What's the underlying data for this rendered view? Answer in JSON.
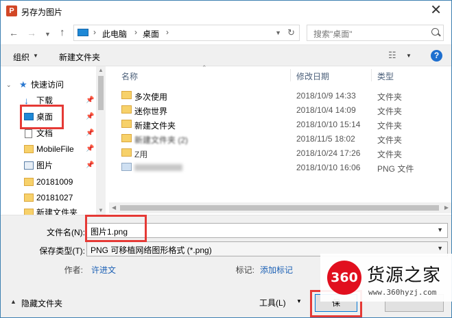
{
  "window": {
    "title": "另存为图片"
  },
  "nav": {
    "breadcrumbs": [
      "此电脑",
      "桌面"
    ],
    "search_placeholder": "搜索\"桌面\""
  },
  "toolbar": {
    "organize": "组织",
    "new_folder": "新建文件夹"
  },
  "sidebar": {
    "items": [
      {
        "label": "快速访问",
        "icon": "star-icon"
      },
      {
        "label": "下载",
        "icon": "download-icon"
      },
      {
        "label": "桌面",
        "icon": "desktop-icon"
      },
      {
        "label": "文档",
        "icon": "document-icon"
      },
      {
        "label": "MobileFile",
        "icon": "folder-icon"
      },
      {
        "label": "图片",
        "icon": "pictures-icon"
      },
      {
        "label": "20181009",
        "icon": "folder-icon"
      },
      {
        "label": "20181027",
        "icon": "folder-icon"
      },
      {
        "label": "新建文件夹",
        "icon": "folder-icon"
      }
    ]
  },
  "file_list": {
    "columns": [
      "名称",
      "修改日期",
      "类型"
    ],
    "rows": [
      {
        "name": "多次使用",
        "date": "2018/10/9 14:33",
        "type": "文件夹"
      },
      {
        "name": "迷你世界",
        "date": "2018/10/4 14:09",
        "type": "文件夹"
      },
      {
        "name": "新建文件夹",
        "date": "2018/10/10 15:14",
        "type": "文件夹"
      },
      {
        "name": "新建文件夹 (2)",
        "date": "2018/11/5 18:02",
        "type": "文件夹"
      },
      {
        "name": "Z用",
        "date": "2018/10/24 17:26",
        "type": "文件夹"
      },
      {
        "name": "",
        "date": "2018/10/10 16:06",
        "type": "PNG 文件"
      }
    ]
  },
  "form": {
    "filename_label": "文件名(N):",
    "filename_value": "图片1.png",
    "filetype_label": "保存类型(T):",
    "filetype_value": "PNG 可移植网络图形格式 (*.png)",
    "author_label": "作者:",
    "author_value": "许进文",
    "tags_label": "标记:",
    "tags_value": "添加标记"
  },
  "footer": {
    "hide_folders": "隐藏文件夹",
    "tools": "工具(L)",
    "save": "保"
  },
  "watermark": {
    "badge": "360",
    "name": "货源之家",
    "url": "www.360hyzj.com"
  },
  "colors": {
    "highlight_red": "#e53935",
    "link_blue": "#1a5fb4",
    "help_blue": "#1e6fcf"
  }
}
